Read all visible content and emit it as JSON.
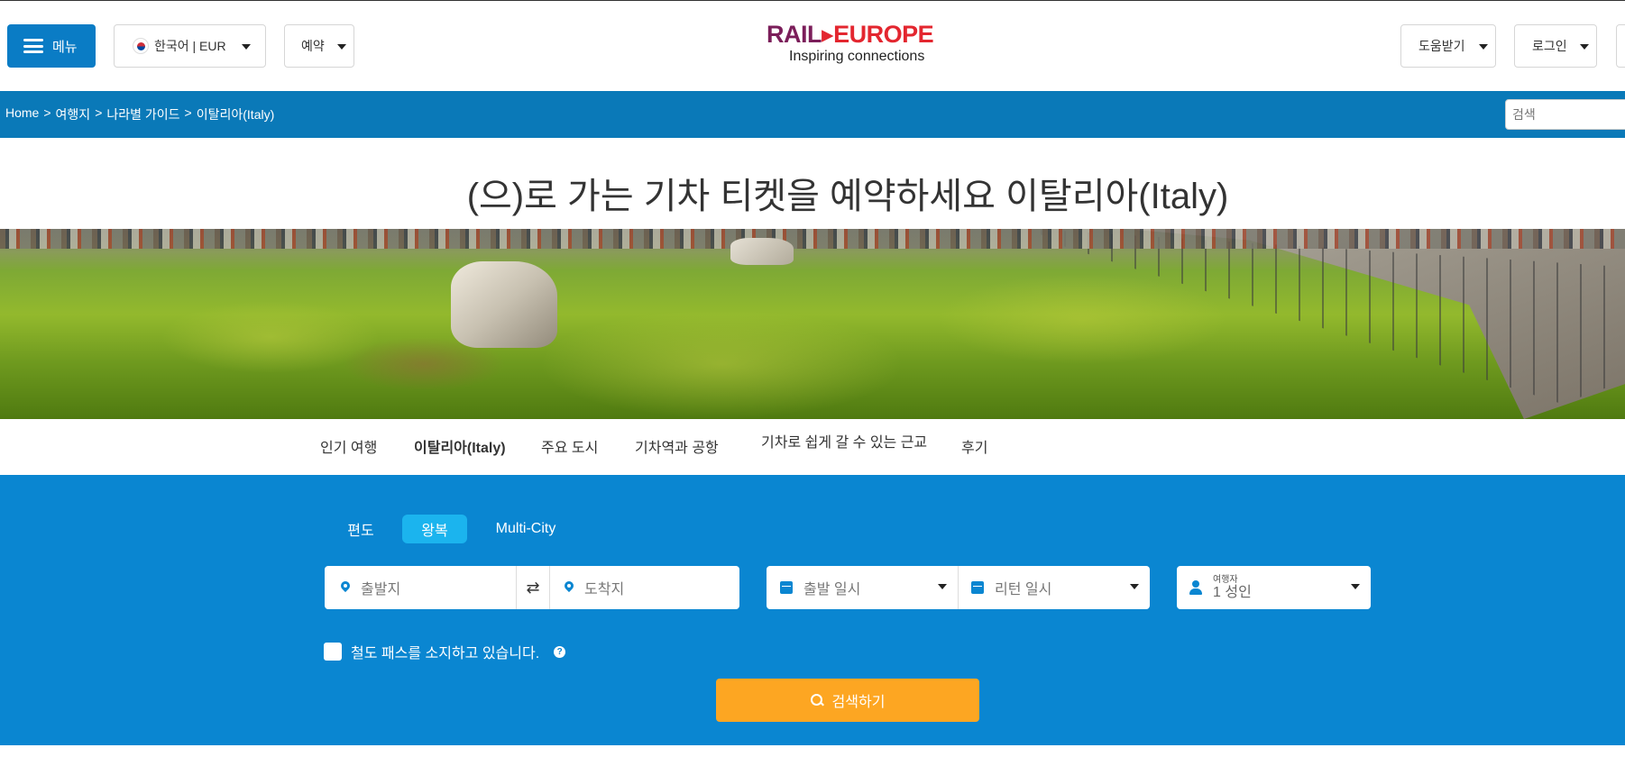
{
  "header": {
    "menu_label": "메뉴",
    "language_label": "한국어 | EUR",
    "booking_label": "예약",
    "help_label": "도움받기",
    "login_label": "로그인",
    "logo_main_left": "RAIL",
    "logo_main_right": "EUROPE",
    "logo_tagline": "Inspiring connections"
  },
  "breadcrumb": {
    "items": [
      "Home",
      ">",
      "여행지",
      ">",
      "나라별 가이드",
      ">",
      "이탈리아(Italy)"
    ],
    "search_placeholder": "검색"
  },
  "page_title": "(으)로 가는 기차 티켓을 예약하세요 이탈리아(Italy)",
  "tabs": [
    {
      "label": "인기 여행"
    },
    {
      "label": "이탈리아(Italy)"
    },
    {
      "label": "주요 도시"
    },
    {
      "label": "기차역과 공항"
    },
    {
      "label": "기차로 쉽게 갈 수 있는 근교"
    },
    {
      "label": "후기"
    }
  ],
  "search_panel": {
    "trip_types": [
      "편도",
      "왕복",
      "Multi-City"
    ],
    "selected_trip_type": "왕복",
    "origin_placeholder": "출발지",
    "destination_placeholder": "도착지",
    "depart_placeholder": "출발 일시",
    "return_placeholder": "리턴 일시",
    "passengers_label": "여행자",
    "passengers_value": "1 성인",
    "rail_pass_label": "철도 패스를 소지하고 있습니다.",
    "help_glyph": "?",
    "search_button": "검색하기"
  },
  "colors": {
    "brand_blue": "#0a86d1",
    "breadcrumb_blue": "#0a79b8",
    "active_tab": "#1bb4ee",
    "search_orange": "#fda622",
    "logo_purple": "#7b1e5a",
    "logo_red": "#e3262f"
  }
}
